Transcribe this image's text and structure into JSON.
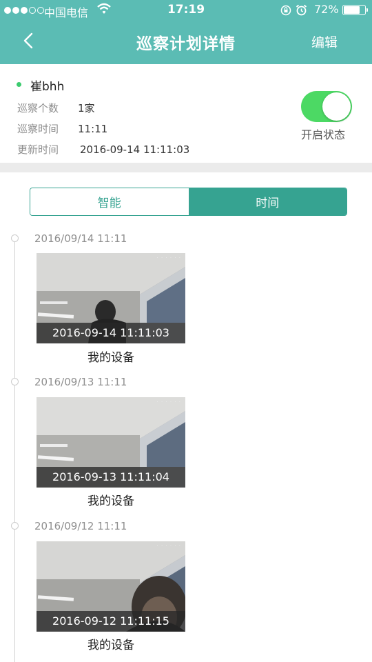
{
  "status_bar": {
    "carrier": "中国电信",
    "time": "17:19",
    "battery": "72%",
    "battery_level": 0.72,
    "icons": [
      "signal-icon",
      "wifi-icon",
      "rotation-lock-icon",
      "alarm-icon",
      "battery-icon"
    ]
  },
  "nav": {
    "back_icon": "chevron-left-icon",
    "title": "巡察计划详情",
    "edit_label": "编辑"
  },
  "plan": {
    "name": "崔bhh",
    "rows": [
      {
        "label": "巡察个数",
        "value": "1家"
      },
      {
        "label": "巡察时间",
        "value": "11:11"
      },
      {
        "label": "更新时间",
        "value": "2016-09-14 11:11:03"
      }
    ],
    "toggle_on": true,
    "toggle_label": "开启状态"
  },
  "tabs": {
    "items": [
      {
        "label": "智能",
        "active": false
      },
      {
        "label": "时间",
        "active": true
      }
    ]
  },
  "timeline": [
    {
      "date": "2016/09/14 11:11",
      "stamp": "2016-09-14 11:11:03",
      "device": "我的设备"
    },
    {
      "date": "2016/09/13 11:11",
      "stamp": "2016-09-13 11:11:04",
      "device": "我的设备"
    },
    {
      "date": "2016/09/12 11:11",
      "stamp": "2016-09-12 11:11:15",
      "device": "我的设备"
    }
  ],
  "colors": {
    "header": "#5bbcb4",
    "accent": "#36a391",
    "toggle": "#4cd964"
  }
}
